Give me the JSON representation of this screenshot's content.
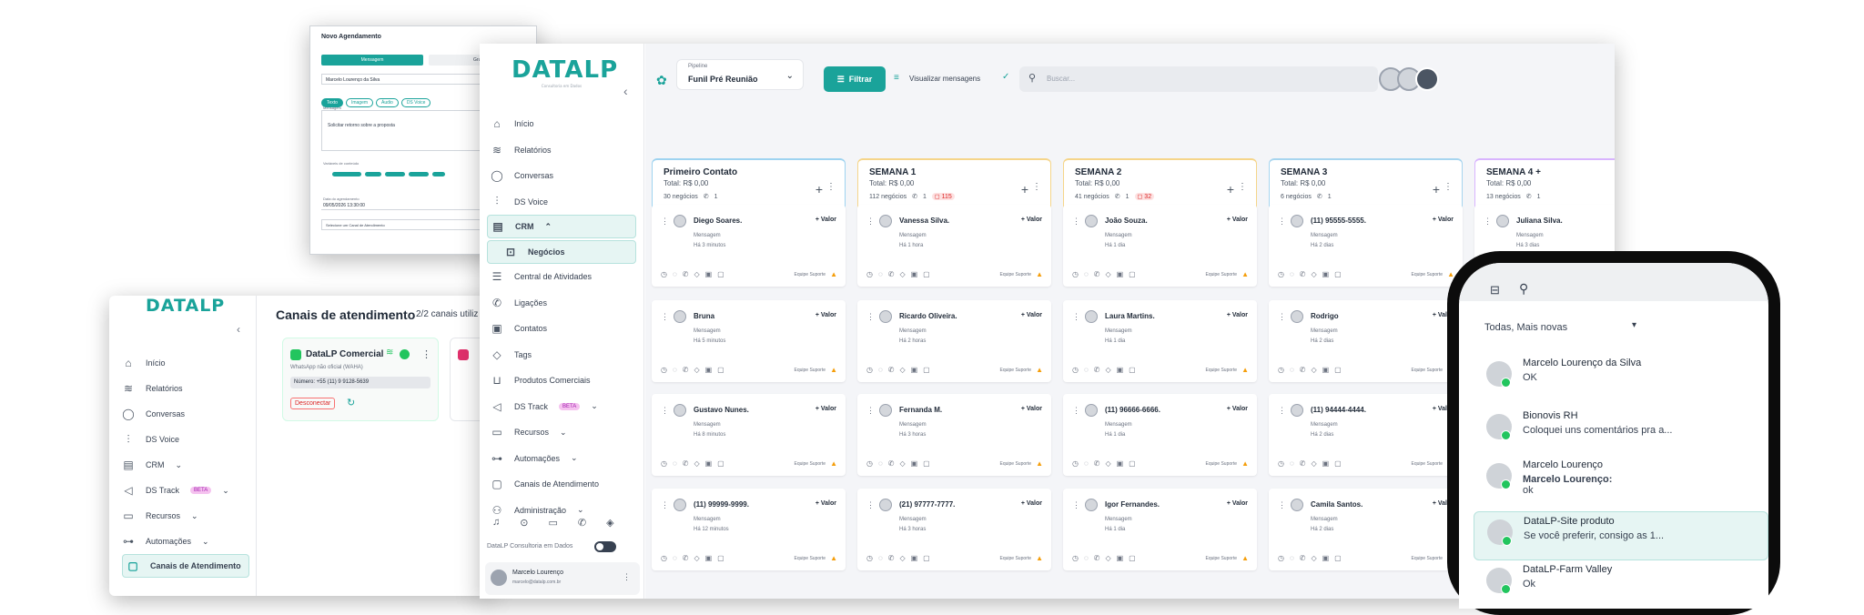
{
  "brand": {
    "logo": "DATALP",
    "logo_sub": "Consultoria em Dados"
  },
  "modal": {
    "title": "Novo Agendamento",
    "tab_msg": "Mensagem",
    "tab_other": "Grupo",
    "contact": "Marcelo Lourenço da Silva",
    "types": [
      "Texto",
      "Imagem",
      "Áudio",
      "DS Voice"
    ],
    "msg_label": "Mensagem",
    "msg_value": "Solicitar retorno sobre a proposta",
    "var_label": "Variáveis de conteúdo",
    "date_label": "Data do agendamento",
    "date_value": "09/05/2026 13:30:00",
    "channel_placeholder": "Selecione um Canal de Atendimento"
  },
  "left_app": {
    "menu": [
      "Início",
      "Relatórios",
      "Conversas",
      "DS Voice",
      "CRM",
      "DS Track",
      "Recursos",
      "Automações",
      "Canais de Atendimento"
    ],
    "beta": "BETA",
    "page_title": "Canais de atendimento",
    "page_count": "2/2 canais utiliz",
    "channel": {
      "name": "DataLP Comercial",
      "sub": "WhatsApp não oficial (WAHA)",
      "number": "Número: +55 (11) 9 9128-5639",
      "disconnect": "Desconectar"
    }
  },
  "main_app": {
    "pipeline_label": "Pipeline",
    "pipeline_value": "Funil Pré Reunião",
    "filter": "Filtrar",
    "view_messages": "Visualizar mensagens",
    "search_placeholder": "Buscar...",
    "menu": [
      "Início",
      "Relatórios",
      "Conversas",
      "DS Voice",
      "CRM",
      "Negócios",
      "Central de Atividades",
      "Ligações",
      "Contatos",
      "Tags",
      "Produtos Comerciais",
      "DS Track",
      "Recursos",
      "Automações",
      "Canais de Atendimento",
      "Administração"
    ],
    "beta": "BETA",
    "footer_company": "DataLP Consultoria em Dados",
    "user_name": "Marcelo Lourenço",
    "user_email": "marcelo@datalp.com.br",
    "columns": [
      {
        "title": "Primeiro Contato",
        "total": "Total: R$ 0,00",
        "count": "30 negócios",
        "calls": "1",
        "badge": "",
        "color": "#9ed3f0",
        "cards": [
          {
            "name": "Diego Soares.",
            "time": "Há 3 minutos"
          },
          {
            "name": "Bruna",
            "time": "Há 5 minutos"
          },
          {
            "name": "Gustavo Nunes.",
            "time": "Há 8 minutos"
          },
          {
            "name": "(11) 99999-9999.",
            "time": "Há 12 minutos"
          }
        ]
      },
      {
        "title": "SEMANA 1",
        "total": "Total: R$ 0,00",
        "count": "112 negócios",
        "calls": "1",
        "badge": "115",
        "color": "#f5d58a",
        "cards": [
          {
            "name": "Vanessa Silva.",
            "time": "Há 1 hora"
          },
          {
            "name": "Ricardo Oliveira.",
            "time": "Há 2 horas"
          },
          {
            "name": "Fernanda M.",
            "time": "Há 3 horas"
          },
          {
            "name": "(21) 97777-7777.",
            "time": "Há 3 horas"
          }
        ]
      },
      {
        "title": "SEMANA 2",
        "total": "Total: R$ 0,00",
        "count": "41 negócios",
        "calls": "1",
        "badge": "32",
        "color": "#f5d58a",
        "cards": [
          {
            "name": "João Souza.",
            "time": "Há 1 dia"
          },
          {
            "name": "Laura Martins.",
            "time": "Há 1 dia"
          },
          {
            "name": "(11) 96666-6666.",
            "time": "Há 1 dia"
          },
          {
            "name": "Igor Fernandes.",
            "time": "Há 1 dia"
          }
        ]
      },
      {
        "title": "SEMANA 3",
        "total": "Total: R$ 0,00",
        "count": "6 negócios",
        "calls": "1",
        "badge": "",
        "color": "#a7d5ef",
        "cards": [
          {
            "name": "(11) 95555-5555.",
            "time": "Há 2 dias"
          },
          {
            "name": "Rodrigo",
            "time": "Há 2 dias"
          },
          {
            "name": "(11) 94444-4444.",
            "time": "Há 2 dias"
          },
          {
            "name": "Camila Santos.",
            "time": "Há 2 dias"
          }
        ]
      },
      {
        "title": "SEMANA 4 +",
        "total": "Total: R$ 0,00",
        "count": "13 negócios",
        "calls": "1",
        "badge": "",
        "color": "#d8b4fe",
        "cards": [
          {
            "name": "Juliana Silva.",
            "time": "Há 3 dias"
          }
        ]
      }
    ],
    "card_msg": "Mensagem",
    "card_valor": "+ Valor",
    "card_team": "Equipe Suporte"
  },
  "phone": {
    "filter": "Todas, Mais novas",
    "chats": [
      {
        "name": "Marcelo Lourenço da Silva",
        "preview": "OK",
        "bold": ""
      },
      {
        "name": "Bionovis RH",
        "preview": "Coloquei uns comentários pra a...",
        "bold": ""
      },
      {
        "name": "Marcelo Lourenço",
        "preview": "ok",
        "bold": "Marcelo Lourenço:"
      },
      {
        "name": "DataLP-Site produto",
        "preview": "Se você preferir, consigo as 1...",
        "bold": ""
      },
      {
        "name": "DataLP-Farm Valley",
        "preview": "Ok",
        "bold": ""
      }
    ]
  }
}
